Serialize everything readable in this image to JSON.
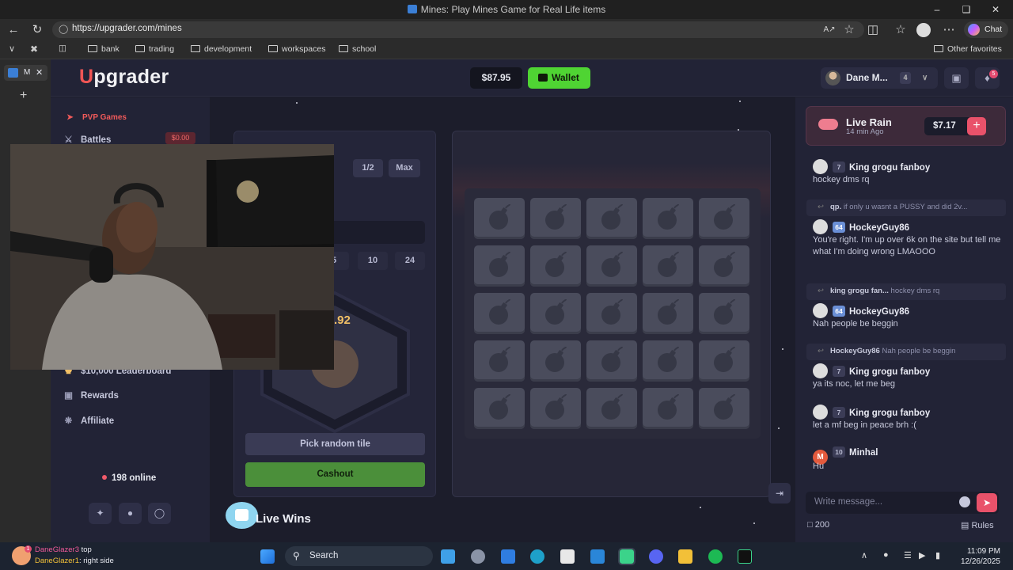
{
  "browser": {
    "window_title": "Mines: Play Mines Game for Real Life items",
    "url": "https://upgrader.com/mines",
    "bookmarks": [
      "bank",
      "trading",
      "development",
      "workspaces",
      "school"
    ],
    "other_favorites": "Other favorites",
    "chat_label": "Chat",
    "tab_label": "M"
  },
  "header": {
    "logo_mark": "U",
    "logo_text": "pgrader",
    "balance": "$87.95",
    "wallet_label": "Wallet",
    "username": "Dane M...",
    "user_level": "4",
    "notification_count": "5"
  },
  "sidebar": {
    "section_label": "PVP Games",
    "battles_label": "Battles",
    "battles_amount": "$0.00",
    "leaderboard_label": "$10,000 Leaderboard",
    "rewards_label": "Rewards",
    "affiliate_label": "Affiliate",
    "online_text": "198 online"
  },
  "game": {
    "half_label": "1/2",
    "max_label": "Max",
    "mine_options": [
      "5",
      "10",
      "24"
    ],
    "multiplier_fragment": ".92",
    "pick_random_label": "Pick random tile",
    "cashout_label": "Cashout",
    "live_wins_label": "Live Wins",
    "grid_rows": 5,
    "grid_cols": 5
  },
  "chat": {
    "rain_title": "Live Rain",
    "rain_time": "14 min Ago",
    "rain_amount": "$7.17",
    "messages": [
      {
        "user": "King grogu fanboy",
        "level": "7",
        "text": "hockey dms rq"
      },
      {
        "user": "HockeyGuy86",
        "level": "64",
        "text": "You're right. I'm up over 6k on the site but tell me what I'm doing wrong LMAOOO"
      },
      {
        "user": "HockeyGuy86",
        "level": "64",
        "text": "Nah people be beggin"
      },
      {
        "user": "King grogu fanboy",
        "level": "7",
        "text": "ya its noc, let me beg"
      },
      {
        "user": "King grogu fanboy",
        "level": "7",
        "text": "let a mf beg in peace brh :("
      },
      {
        "user": "Minhal",
        "level": "10",
        "text": "Hu",
        "initial": "M"
      }
    ],
    "replies": [
      {
        "user": "qp.",
        "text": "if only u wasnt a PUSSY and did 2v..."
      },
      {
        "user": "king grogu fan...",
        "text": "hockey dms rq"
      },
      {
        "user": "HockeyGuy86",
        "text": "Nah people be beggin"
      }
    ],
    "input_placeholder": "Write message...",
    "online_count": "200",
    "rules_label": "Rules"
  },
  "taskbar": {
    "search_label": "Search",
    "time": "11:09 PM",
    "date": "12/26/2025",
    "notification_line1_user": "DaneGlazer3",
    "notification_line1_text": "top",
    "notification_line2_user": "DaneGlazer1",
    "notification_line2_text": "right side"
  },
  "colors": {
    "accent_red": "#f05555",
    "wallet_green": "#4fd433",
    "cashout_green": "#4b8f3a",
    "panel_bg": "#242539"
  }
}
